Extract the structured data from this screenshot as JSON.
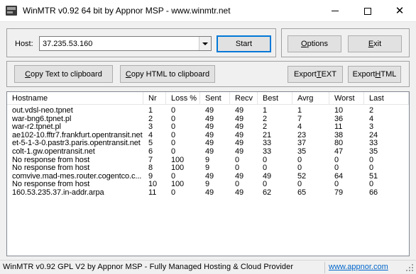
{
  "window": {
    "title": "WinMTR v0.92 64 bit by Appnor MSP - www.winmtr.net"
  },
  "host": {
    "label": "Host:",
    "value": "37.235.53.160"
  },
  "buttons": {
    "start": "Start",
    "options": "Options",
    "exit": "Exit",
    "copy_text": "Copy Text to clipboard",
    "copy_html": "Copy HTML to clipboard",
    "export_text": "Export TEXT",
    "export_html": "Export HTML"
  },
  "table": {
    "columns": [
      "Hostname",
      "Nr",
      "Loss %",
      "Sent",
      "Recv",
      "Best",
      "Avrg",
      "Worst",
      "Last"
    ],
    "rows": [
      [
        "out.vdsl-neo.tpnet",
        "1",
        "0",
        "49",
        "49",
        "1",
        "1",
        "10",
        "2"
      ],
      [
        "war-bng6.tpnet.pl",
        "2",
        "0",
        "49",
        "49",
        "2",
        "7",
        "36",
        "4"
      ],
      [
        "war-r2.tpnet.pl",
        "3",
        "0",
        "49",
        "49",
        "2",
        "4",
        "11",
        "3"
      ],
      [
        "ae102-10.fftr7.frankfurt.opentransit.net",
        "4",
        "0",
        "49",
        "49",
        "21",
        "23",
        "38",
        "24"
      ],
      [
        "et-5-1-3-0.pastr3.paris.opentransit.net",
        "5",
        "0",
        "49",
        "49",
        "33",
        "37",
        "80",
        "33"
      ],
      [
        "colt-1.gw.opentransit.net",
        "6",
        "0",
        "49",
        "49",
        "33",
        "35",
        "47",
        "35"
      ],
      [
        "No response from host",
        "7",
        "100",
        "9",
        "0",
        "0",
        "0",
        "0",
        "0"
      ],
      [
        "No response from host",
        "8",
        "100",
        "9",
        "0",
        "0",
        "0",
        "0",
        "0"
      ],
      [
        "comvive.mad-mes.router.cogentco.c...",
        "9",
        "0",
        "49",
        "49",
        "49",
        "52",
        "64",
        "51"
      ],
      [
        "No response from host",
        "10",
        "100",
        "9",
        "0",
        "0",
        "0",
        "0",
        "0"
      ],
      [
        "160.53.235.37.in-addr.arpa",
        "11",
        "0",
        "49",
        "49",
        "62",
        "65",
        "79",
        "66"
      ]
    ]
  },
  "status": {
    "text": "WinMTR v0.92 GPL V2 by Appnor MSP - Fully Managed Hosting & Cloud Provider",
    "link": "www.appnor.com"
  },
  "colors": {
    "link": "#0066cc",
    "default_button_border": "#0078d7"
  }
}
